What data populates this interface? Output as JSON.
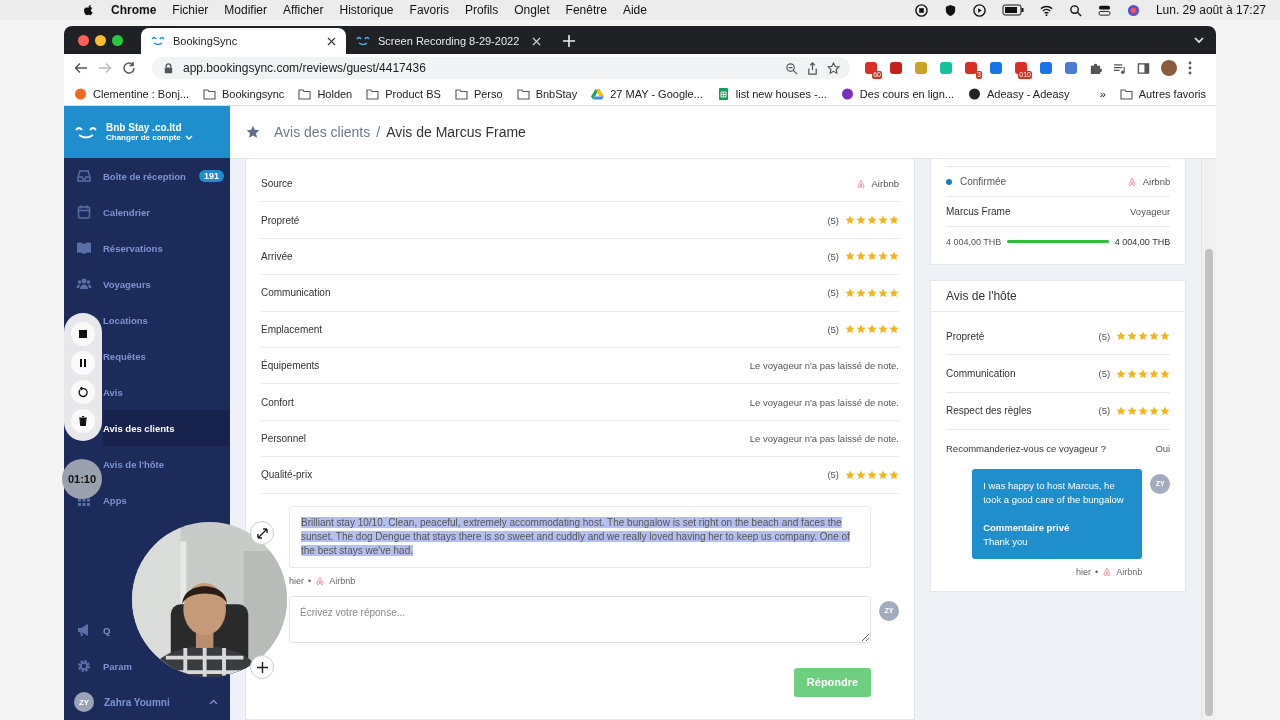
{
  "menu_bar": {
    "app": "Chrome",
    "menus": [
      "Fichier",
      "Modifier",
      "Afficher",
      "Historique",
      "Favoris",
      "Profils",
      "Onglet",
      "Fenêtre",
      "Aide"
    ],
    "clock": "Lun. 29 août à 17:27"
  },
  "browser": {
    "tabs": [
      {
        "title": "BookingSync",
        "selected": true
      },
      {
        "title": "Screen Recording 8-29-2022",
        "selected": false
      }
    ],
    "url": "app.bookingsync.com/reviews/guest/4417436",
    "extensions": [
      {
        "color": "#d93025",
        "badge": "60"
      },
      {
        "color": "#c5221f"
      },
      {
        "color": "#c9a227"
      },
      {
        "color": "#15c39a"
      },
      {
        "color": "#d93025",
        "badge": "3"
      },
      {
        "color": "#1a73e8"
      },
      {
        "color": "#d93025",
        "badge": "010"
      },
      {
        "color": "#1a73e8"
      },
      {
        "color": "#4a7bd0"
      }
    ],
    "bookmarks": [
      {
        "label": "Clementine : Bonj...",
        "kind": "site",
        "color": "#f26a1b"
      },
      {
        "label": "Bookingsync",
        "kind": "folder"
      },
      {
        "label": "Holden",
        "kind": "folder"
      },
      {
        "label": "Product BS",
        "kind": "folder"
      },
      {
        "label": "Perso",
        "kind": "folder"
      },
      {
        "label": "BnbStay",
        "kind": "folder"
      },
      {
        "label": "27 MAY - Google...",
        "kind": "drive"
      },
      {
        "label": "list new houses -...",
        "kind": "sheet"
      },
      {
        "label": "Des cours en lign...",
        "kind": "site",
        "color": "#7b2fbe"
      },
      {
        "label": "Adeasy - Adeasy",
        "kind": "site",
        "color": "#222222"
      }
    ],
    "more": "»",
    "other_bookmarks": "Autres favoris"
  },
  "sidebar": {
    "account": {
      "name": "Bnb Stay .co.ltd",
      "switch": "Changer de compte"
    },
    "items": [
      {
        "label": "Boîte de réception",
        "badge": "191",
        "selected": false
      },
      {
        "label": "Calendrier",
        "selected": false
      },
      {
        "label": "Réservations",
        "selected": false
      },
      {
        "label": "Voyageurs",
        "selected": false
      },
      {
        "label": "Locations",
        "selected": false
      },
      {
        "label": "Requêtes",
        "selected": false
      },
      {
        "label": "Avis",
        "selected": false
      },
      {
        "label": "Avis des clients",
        "selected": true
      },
      {
        "label": "Avis de l'hôte",
        "selected": false
      },
      {
        "label": "Apps",
        "selected": false
      }
    ],
    "bottom_items": [
      {
        "label": "Q",
        "selected": false
      },
      {
        "label": "Param",
        "selected": false
      }
    ],
    "user": {
      "initials": "ZY",
      "name": "Zahra Youmni"
    }
  },
  "recorder": {
    "timer": "01:10"
  },
  "breadcrumb": {
    "parent": "Avis des clients",
    "separator": "/",
    "current": "Avis de Marcus Frame"
  },
  "review_details": [
    {
      "label": "Source",
      "kind": "source",
      "value": "Airbnb"
    },
    {
      "label": "Propreté",
      "kind": "rating",
      "score": "(5)",
      "stars": 5
    },
    {
      "label": "Arrivée",
      "kind": "rating",
      "score": "(5)",
      "stars": 5
    },
    {
      "label": "Communication",
      "kind": "rating",
      "score": "(5)",
      "stars": 5
    },
    {
      "label": "Emplacement",
      "kind": "rating",
      "score": "(5)",
      "stars": 5
    },
    {
      "label": "Équipements",
      "kind": "note",
      "value": "Le voyageur n'a pas laissé de note."
    },
    {
      "label": "Confort",
      "kind": "note",
      "value": "Le voyageur n'a pas laissé de note."
    },
    {
      "label": "Personnel",
      "kind": "note",
      "value": "Le voyageur n'a pas laissé de note."
    },
    {
      "label": "Qualité-prix",
      "kind": "rating",
      "score": "(5)",
      "stars": 5
    }
  ],
  "guest_review": {
    "text": "Brilliant stay 10/10. Clean, peaceful, extremely accommodating host. The bungalow is set right on the beach and faces the sunset. The dog Dengue that stays there is so sweet and cuddly and we really loved having her to keep us company. One of the best stays we've had.",
    "highlighted": true,
    "time": "hier",
    "separator": "•",
    "source": "Airbnb"
  },
  "reply": {
    "placeholder": "Écrivez votre réponse...",
    "avatar": "ZY",
    "button": "Répondre"
  },
  "booking": {
    "status": "Confirmée",
    "source": "Airbnb",
    "guest": "Marcus Frame",
    "role": "Voyageur",
    "paid": "4 004,00 THB",
    "total": "4 004,00 THB",
    "level": 1
  },
  "host_review": {
    "title": "Avis de l'hôte",
    "rows": [
      {
        "label": "Propreté",
        "score": "(5)",
        "stars": 5
      },
      {
        "label": "Communication",
        "score": "(5)",
        "stars": 5
      },
      {
        "label": "Respect des règles",
        "score": "(5)",
        "stars": 5
      }
    ],
    "question": {
      "label": "Recommanderiez-vous ce voyageur ?",
      "value": "Oui"
    },
    "message": {
      "text": "I was happy to host Marcus, he took a good care of the bungalow",
      "private_label": "Commentaire privé",
      "private_text": "Thank you",
      "avatar": "ZY",
      "time": "hier",
      "separator": "•",
      "source": "Airbnb"
    }
  }
}
